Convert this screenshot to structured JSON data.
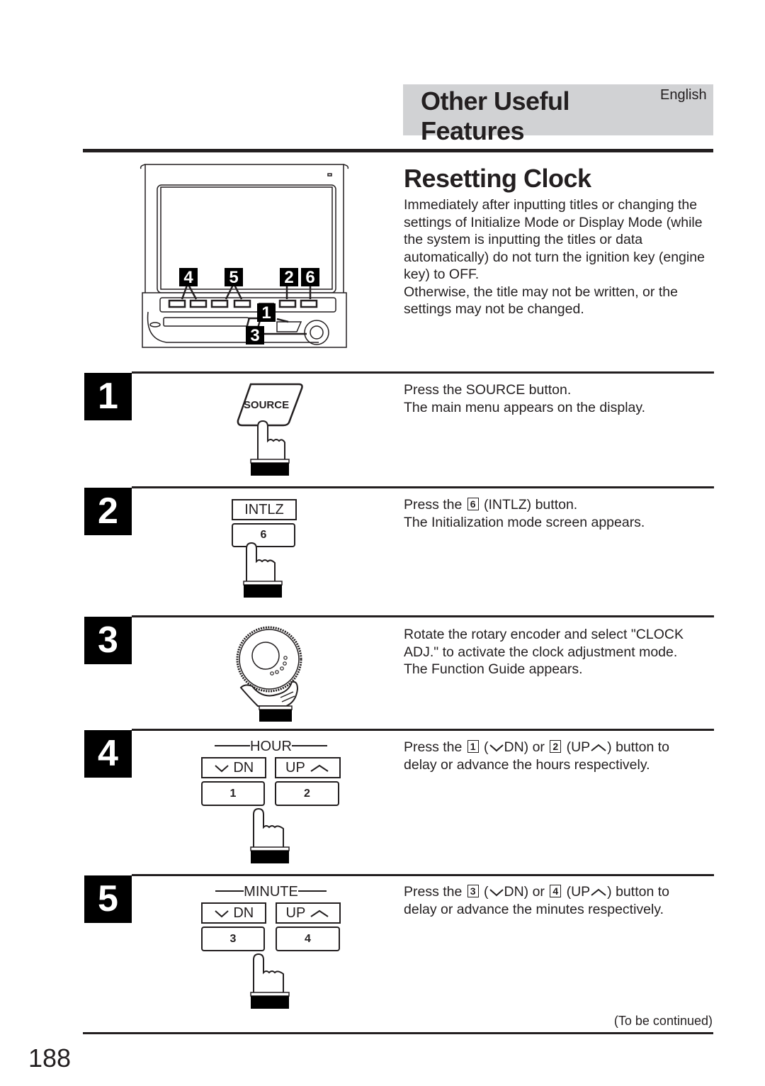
{
  "header": {
    "section_title_line1": "Other Useful",
    "section_title_line2": "Features",
    "language": "English"
  },
  "intro": {
    "heading": "Resetting Clock",
    "paragraph1": "Immediately after inputting titles or changing the settings of Initialize Mode or Display Mode (while the system is inputting the titles or data automatically) do not turn the ignition key (engine key) to OFF.",
    "paragraph2": "Otherwise, the title may not be written, or the settings may not be changed."
  },
  "device_callouts": [
    "4",
    "5",
    "2",
    "6",
    "1",
    "3"
  ],
  "steps": [
    {
      "number": "1",
      "illustration": {
        "button_label": "SOURCE"
      },
      "line1": "Press the SOURCE button.",
      "line2": "The main menu appears on the display."
    },
    {
      "number": "2",
      "illustration": {
        "function_label": "INTLZ",
        "key_label": "6"
      },
      "line1_prefix": "Press the",
      "line1_key": "6",
      "line1_suffix": "(INTLZ) button.",
      "line2": "The Initialization mode screen appears."
    },
    {
      "number": "3",
      "illustration": {
        "control": "rotary-encoder"
      },
      "line1": "Rotate the rotary encoder and select \"CLOCK",
      "line2": "ADJ.\" to activate the clock adjustment mode.",
      "line3": "The Function Guide appears."
    },
    {
      "number": "4",
      "illustration": {
        "group_title": "HOUR",
        "dn_label": "DN",
        "up_label": "UP",
        "dn_key": "1",
        "up_key": "2"
      },
      "prefix": "Press the",
      "key_dn": "1",
      "dn_text": "DN) or",
      "key_up": "2",
      "up_text": "(UP",
      "suffix": ") button to",
      "line2": "delay or advance the hours respectively."
    },
    {
      "number": "5",
      "illustration": {
        "group_title": "MINUTE",
        "dn_label": "DN",
        "up_label": "UP",
        "dn_key": "3",
        "up_key": "4"
      },
      "prefix": "Press the",
      "key_dn": "3",
      "dn_text": "DN) or",
      "key_up": "4",
      "up_text": "(UP",
      "suffix": ") button to",
      "line2": "delay or advance the minutes respectively."
    }
  ],
  "footer": {
    "continued": "(To be continued)",
    "page_number": "188"
  },
  "colors": {
    "header_band": "#d1d2d4",
    "ink": "#231f20",
    "step_badge": "#000000"
  }
}
